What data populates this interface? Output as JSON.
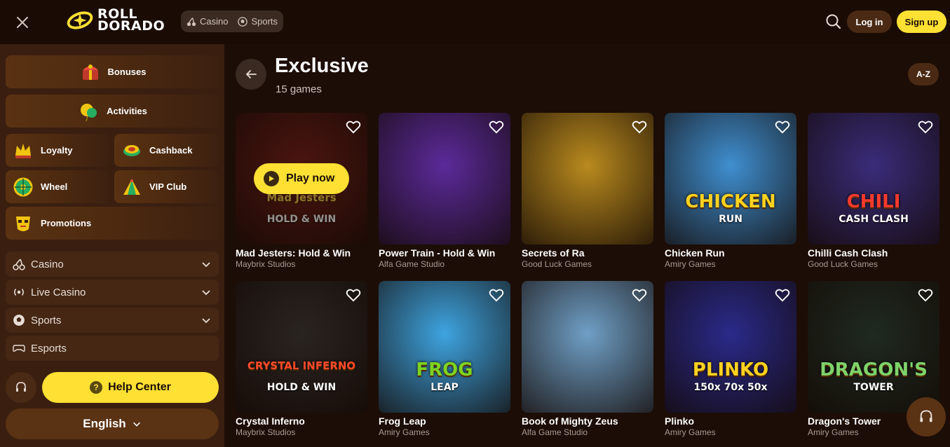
{
  "header": {
    "logo_line1": "ROLL",
    "logo_line2": "DORADO",
    "tabs": [
      {
        "label": "Casino",
        "icon": "cherry-icon"
      },
      {
        "label": "Sports",
        "icon": "soccer-ball-icon"
      }
    ],
    "login_label": "Log in",
    "signup_label": "Sign up"
  },
  "sidebar": {
    "promo_cards": [
      {
        "label": "Bonuses",
        "icon": "treasure-chest-icon"
      },
      {
        "label": "Activities",
        "icon": "balloon-icon"
      },
      {
        "label": "Loyalty",
        "icon": "crown-icon"
      },
      {
        "label": "Cashback",
        "icon": "cashback-coins-icon"
      },
      {
        "label": "Wheel",
        "icon": "wheel-icon"
      },
      {
        "label": "VIP Club",
        "icon": "vip-pyramid-icon"
      },
      {
        "label": "Promotions",
        "icon": "mask-icon"
      }
    ],
    "nav": [
      {
        "label": "Casino",
        "icon": "cherry-icon",
        "expandable": true
      },
      {
        "label": "Live Casino",
        "icon": "live-icon",
        "expandable": true
      },
      {
        "label": "Sports",
        "icon": "soccer-ball-icon",
        "expandable": true
      },
      {
        "label": "Esports",
        "icon": "gamepad-icon",
        "expandable": false
      }
    ],
    "help_label": "Help Center",
    "language_label": "English"
  },
  "main": {
    "title": "Exclusive",
    "subtitle": "15 games",
    "sort_label": "A-Z",
    "play_now_label": "Play now",
    "games": [
      {
        "name": "Mad Jesters: Hold & Win",
        "studio": "Maybrix Studios",
        "bg": "#7a1d1a",
        "art": "Mad Jesters",
        "art2": "HOLD & WIN",
        "art_color": "#f2c94c",
        "hovered": true
      },
      {
        "name": "Power Train - Hold & Win",
        "studio": "Alfa Game Studio",
        "bg": "#5b2a9a",
        "art": "",
        "art2": "",
        "art_color": "#f2c94c",
        "hovered": false
      },
      {
        "name": "Secrets of Ra",
        "studio": "Good Luck Games",
        "bg": "#b98a1e",
        "art": "",
        "art2": "",
        "art_color": "#fff",
        "hovered": false
      },
      {
        "name": "Chicken Run",
        "studio": "Amiry Games",
        "bg": "#3f8fd0",
        "art": "CHICKEN",
        "art2": "RUN",
        "art_color": "#ffd21f",
        "hovered": false
      },
      {
        "name": "Chilli Cash Clash",
        "studio": "Good Luck Games",
        "bg": "#3a2c7a",
        "art": "CHILI",
        "art2": "CASH CLASH",
        "art_color": "#ff3a2e",
        "hovered": false
      },
      {
        "name": "Crystal Inferno",
        "studio": "Maybrix Studios",
        "bg": "#2a2420",
        "art": "CRYSTAL INFERNO",
        "art2": "HOLD & WIN",
        "art_color": "#ff4a2a",
        "hovered": false
      },
      {
        "name": "Frog Leap",
        "studio": "Amiry Games",
        "bg": "#3ea4e0",
        "art": "FROG",
        "art2": "LEAP",
        "art_color": "#7ed321",
        "hovered": false
      },
      {
        "name": "Book of Mighty Zeus",
        "studio": "Alfa Game Studio",
        "bg": "#6f9fc6",
        "art": "",
        "art2": "",
        "art_color": "#fff",
        "hovered": false
      },
      {
        "name": "Plinko",
        "studio": "Amiry Games",
        "bg": "#2a2a8a",
        "art": "PLINKO",
        "art2": "150x 70x 50x",
        "art_color": "#ffd21f",
        "hovered": false
      },
      {
        "name": "Dragon's Tower",
        "studio": "Amiry Games",
        "bg": "#1f2a20",
        "art": "DRAGON'S",
        "art2": "TOWER",
        "art_color": "#7ed36a",
        "hovered": false
      }
    ]
  },
  "colors": {
    "accent": "#ffe033",
    "background": "#1c0d06",
    "sidebar": "#3a1f10"
  }
}
